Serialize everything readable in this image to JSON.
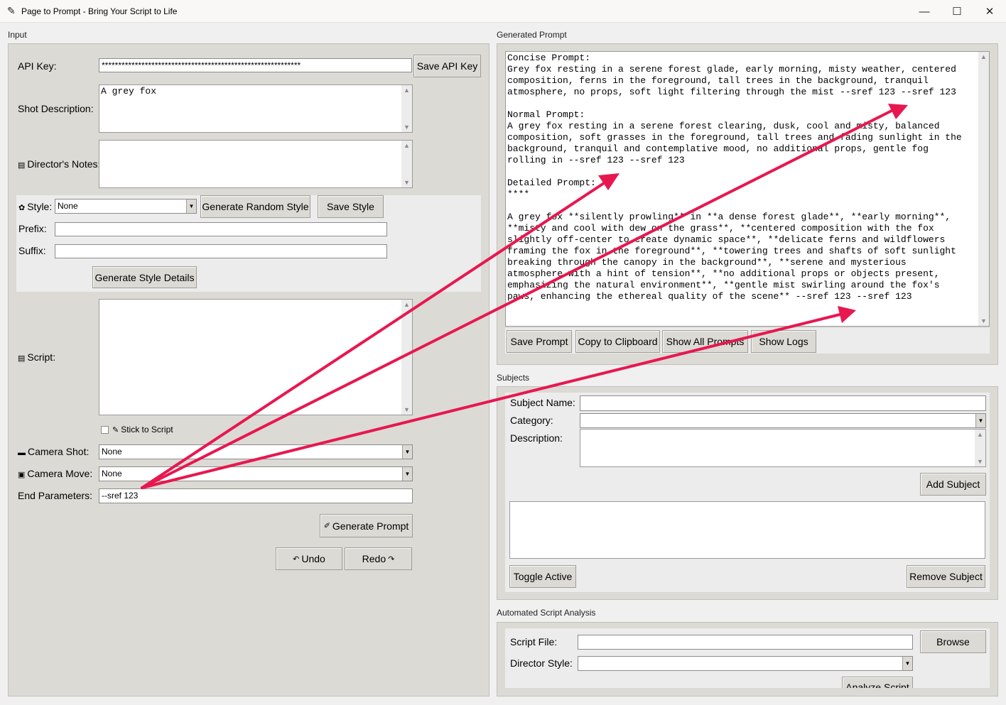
{
  "window": {
    "title": "Page to Prompt - Bring Your Script to Life",
    "icon": "feather-icon",
    "minimize": "—",
    "maximize": "☐",
    "close": "✕"
  },
  "input": {
    "frame_label": "Input",
    "api_key_label": "API Key:",
    "api_key_value": "************************************************************",
    "save_api_key": "Save API Key",
    "shot_description_label": "Shot Description:",
    "shot_description_value": "A grey fox",
    "directors_notes_label": "Director's Notes:",
    "directors_notes_value": "",
    "style_label": "Style:",
    "style_value": "None",
    "generate_random_style": "Generate Random Style",
    "save_style": "Save Style",
    "prefix_label": "Prefix:",
    "prefix_value": "",
    "suffix_label": "Suffix:",
    "suffix_value": "",
    "generate_style_details": "Generate Style Details",
    "script_label": "Script:",
    "script_value": "",
    "stick_to_script": "Stick to Script",
    "camera_shot_label": "Camera Shot:",
    "camera_shot_value": "None",
    "camera_move_label": "Camera Move:",
    "camera_move_value": "None",
    "end_parameters_label": "End Parameters:",
    "end_parameters_value": "--sref 123",
    "generate_prompt": "Generate Prompt",
    "undo": "Undo",
    "redo": "Redo"
  },
  "generated": {
    "frame_label": "Generated Prompt",
    "text": "Concise Prompt:\nGrey fox resting in a serene forest glade, early morning, misty weather, centered\ncomposition, ferns in the foreground, tall trees in the background, tranquil\natmosphere, no props, soft light filtering through the mist --sref 123 --sref 123\n\nNormal Prompt:\nA grey fox resting in a serene forest clearing, dusk, cool and misty, balanced\ncomposition, soft grasses in the foreground, tall trees and fading sunlight in the\nbackground, tranquil and contemplative mood, no additional props, gentle fog\nrolling in --sref 123 --sref 123\n\nDetailed Prompt:\n****\n\nA grey fox **silently prowling** in **a dense forest glade**, **early morning**,\n**misty and cool with dew on the grass**, **centered composition with the fox\nslightly off-center to create dynamic space**, **delicate ferns and wildflowers\nframing the fox in the foreground**, **towering trees and shafts of soft sunlight\nbreaking through the canopy in the background**, **serene and mysterious\natmosphere with a hint of tension**, **no additional props or objects present,\nemphasizing the natural environment**, **gentle mist swirling around the fox's\npaws, enhancing the ethereal quality of the scene** --sref 123 --sref 123",
    "save_prompt": "Save Prompt",
    "copy_to_clipboard": "Copy to Clipboard",
    "show_all_prompts": "Show All Prompts",
    "show_logs": "Show Logs"
  },
  "subjects": {
    "frame_label": "Subjects",
    "name_label": "Subject Name:",
    "name_value": "",
    "category_label": "Category:",
    "category_value": "",
    "description_label": "Description:",
    "description_value": "",
    "add_subject": "Add Subject",
    "list_value": "",
    "toggle_active": "Toggle Active",
    "remove_subject": "Remove Subject"
  },
  "analysis": {
    "frame_label": "Automated Script Analysis",
    "script_file_label": "Script File:",
    "script_file_value": "",
    "browse": "Browse",
    "director_style_label": "Director Style:",
    "director_style_value": "",
    "analyze_script": "Analyze Script"
  },
  "annotation": {
    "color": "#e8174f"
  }
}
